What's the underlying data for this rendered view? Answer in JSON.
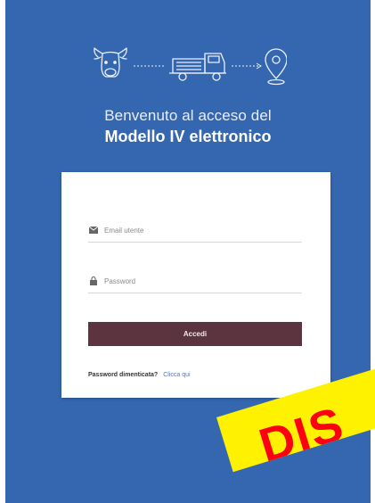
{
  "welcome": {
    "line1": "Benvenuto al acceso del",
    "line2": "Modello IV elettronico"
  },
  "login": {
    "email_placeholder": "Email utente",
    "password_placeholder": "Password",
    "submit_label": "Accedi",
    "forgot_question": "Password dimenticata?",
    "forgot_link": "Clicca qui"
  },
  "icons": {
    "illustration": [
      "cow-icon",
      "truck-icon",
      "location-pin-icon"
    ],
    "email": "envelope-icon",
    "password": "lock-icon"
  },
  "stamp": {
    "text": "DIS"
  },
  "colors": {
    "background": "#3566b0",
    "button": "#5b3440",
    "link": "#4a78c2",
    "stamp_bg": "#fff200",
    "stamp_text": "#ff0010"
  }
}
